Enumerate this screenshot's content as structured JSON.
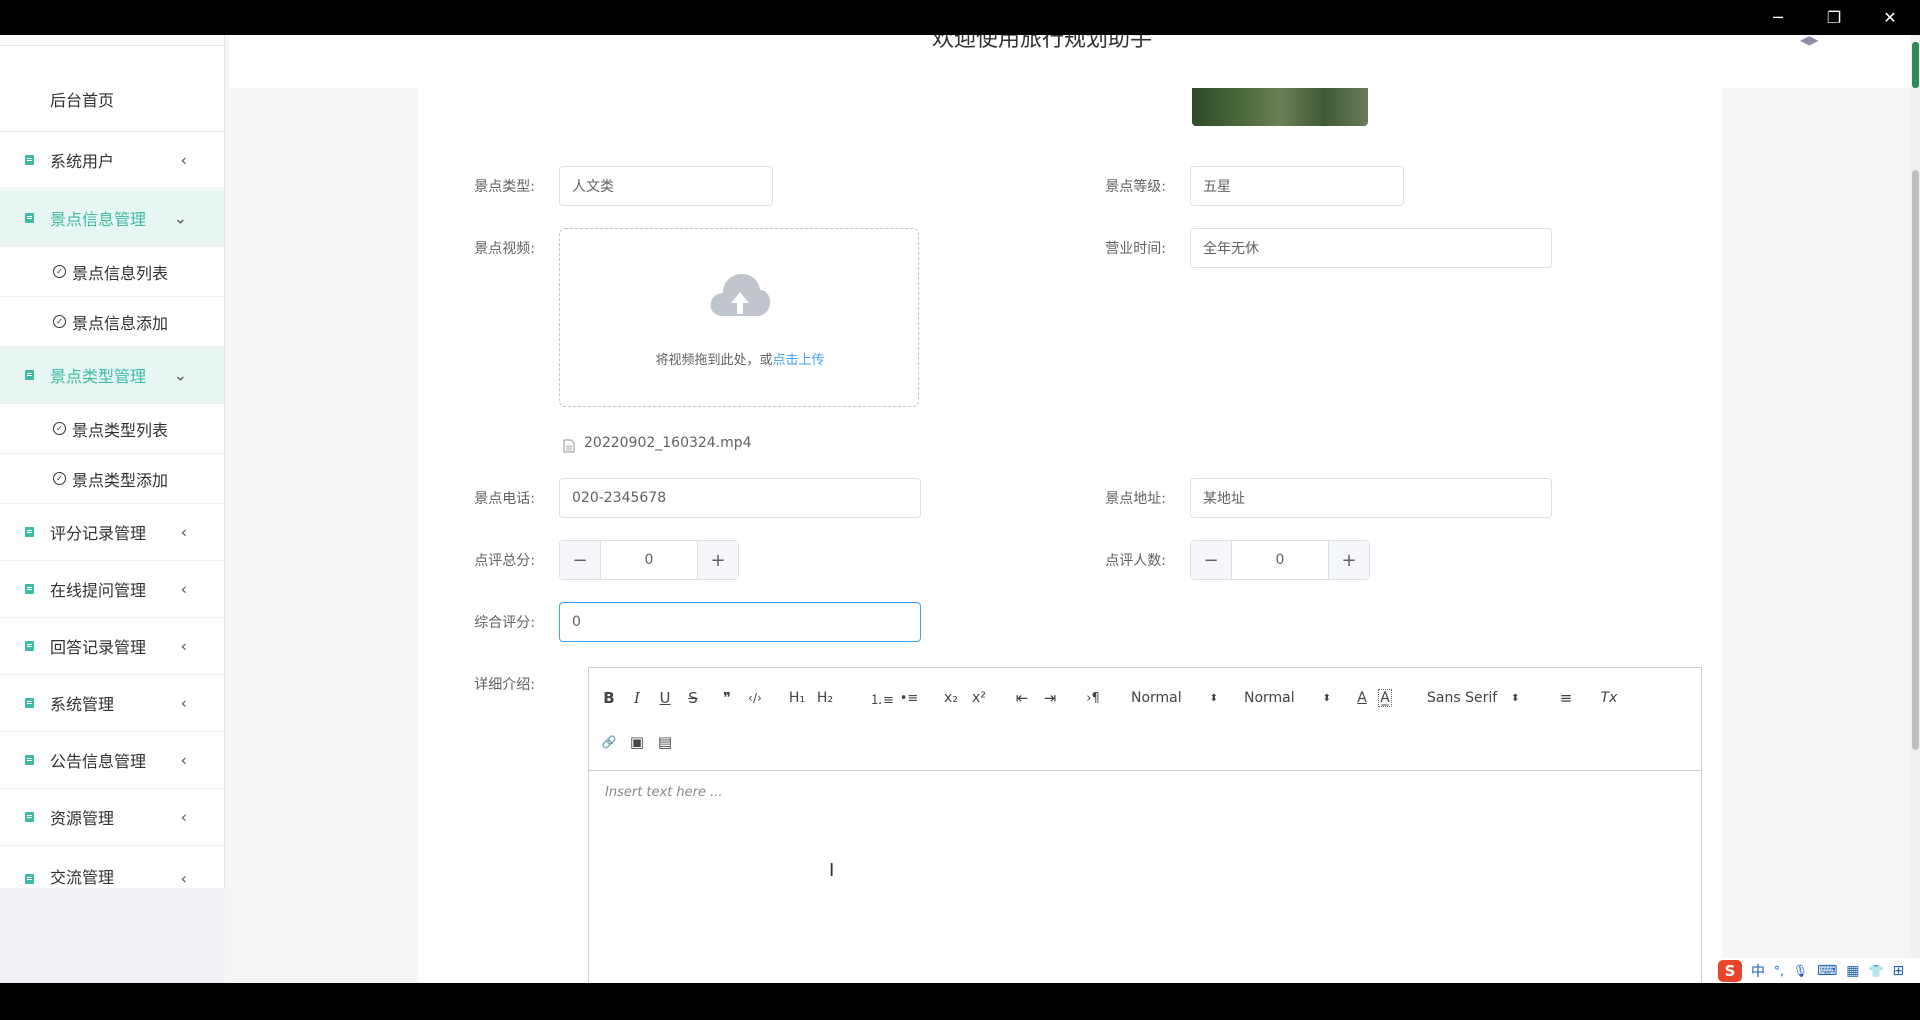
{
  "window": {
    "minimize_icon": "─",
    "restore_icon": "❐",
    "close_icon": "✕"
  },
  "header": {
    "welcome": "欢迎使用旅行规划助手",
    "avatar_icon": "◀▶"
  },
  "sidebar": {
    "home": "后台首页",
    "items": [
      {
        "label": "系统用户",
        "chevron": "‹"
      },
      {
        "label": "景点信息管理",
        "chevron": "⌄"
      },
      {
        "label": "景点信息列表"
      },
      {
        "label": "景点信息添加"
      },
      {
        "label": "景点类型管理",
        "chevron": "⌄"
      },
      {
        "label": "景点类型列表"
      },
      {
        "label": "景点类型添加"
      },
      {
        "label": "评分记录管理",
        "chevron": "‹"
      },
      {
        "label": "在线提问管理",
        "chevron": "‹"
      },
      {
        "label": "回答记录管理",
        "chevron": "‹"
      },
      {
        "label": "系统管理",
        "chevron": "‹"
      },
      {
        "label": "公告信息管理",
        "chevron": "‹"
      },
      {
        "label": "资源管理",
        "chevron": "‹"
      },
      {
        "label": "交流管理",
        "chevron": "‹"
      }
    ],
    "check_icon": "✓"
  },
  "form": {
    "type": {
      "label": "景点类型:",
      "value": "人文类"
    },
    "level": {
      "label": "景点等级:",
      "value": "五星"
    },
    "video": {
      "label": "景点视频:",
      "hint": "将视频拖到此处，或",
      "link": "点击上传",
      "file_name": "20220902_160324.mp4"
    },
    "hours": {
      "label": "营业时间:",
      "value": "全年无休"
    },
    "phone": {
      "label": "景点电话:",
      "value": "020-2345678"
    },
    "address": {
      "label": "景点地址:",
      "value": "某地址"
    },
    "total_score": {
      "label": "点评总分:",
      "value": "0"
    },
    "reviewers": {
      "label": "点评人数:",
      "value": "0"
    },
    "rating": {
      "label": "综合评分:",
      "value": "0"
    },
    "detail": {
      "label": "详细介绍:",
      "placeholder": "Insert text here ..."
    }
  },
  "stepper": {
    "minus": "−",
    "plus": "+"
  },
  "editor": {
    "bold": "B",
    "italic": "I",
    "underline": "U",
    "strike": "S",
    "quote": "❞",
    "code": "‹/›",
    "h1": "H₁",
    "h2": "H₂",
    "ordered_list": "⒈≡",
    "bullet_list": "•≡",
    "sub": "x₂",
    "sup": "x²",
    "outdent": "⇤",
    "indent": "⇥",
    "direction": "›¶",
    "size": "Normal",
    "header": "Normal",
    "font": "Sans Serif",
    "color": "A",
    "background": "A̲",
    "align": "≡",
    "clean": "Tx",
    "link": "🔗",
    "image": "▣",
    "video": "▤",
    "arrow": "⬍"
  },
  "tray": {
    "ime": "中",
    "punct": "°,",
    "mic": "🎙",
    "keyboard": "⌨",
    "apps": "▦",
    "shirt": "👕",
    "grid": "⊞"
  }
}
